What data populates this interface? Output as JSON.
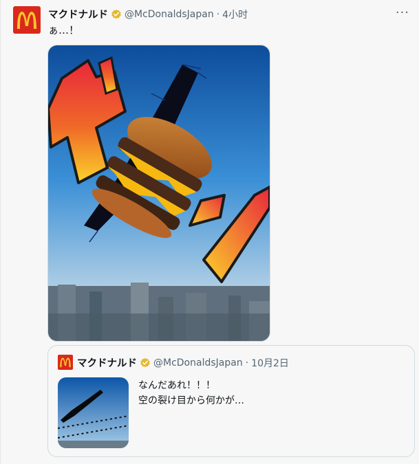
{
  "tweet": {
    "display_name": "マクドナルド",
    "handle": "@McDonaldsJapan",
    "separator": "·",
    "time": "4小时",
    "text": "ぁ…！",
    "more_label": "···",
    "avatar_icon": "mcdonalds-logo-icon",
    "verified_icon": "verified-badge-icon",
    "media": {
      "onomatopoeia_icon": "do-onomatopoeia-graphic",
      "burger_icon": "triple-cheeseburger-graphic"
    }
  },
  "quote": {
    "display_name": "マクドナルド",
    "handle": "@McDonaldsJapan",
    "separator": "·",
    "time": "10月2日",
    "text_lines": [
      "なんだあれ！！！",
      "空の裂け目から何かが…"
    ],
    "thumb_icon": "sky-rift-thumbnail"
  },
  "colors": {
    "brand_red": "#da291c",
    "brand_yellow": "#ffc72c",
    "verified_gold": "#e8b829",
    "muted_text": "#536471"
  }
}
